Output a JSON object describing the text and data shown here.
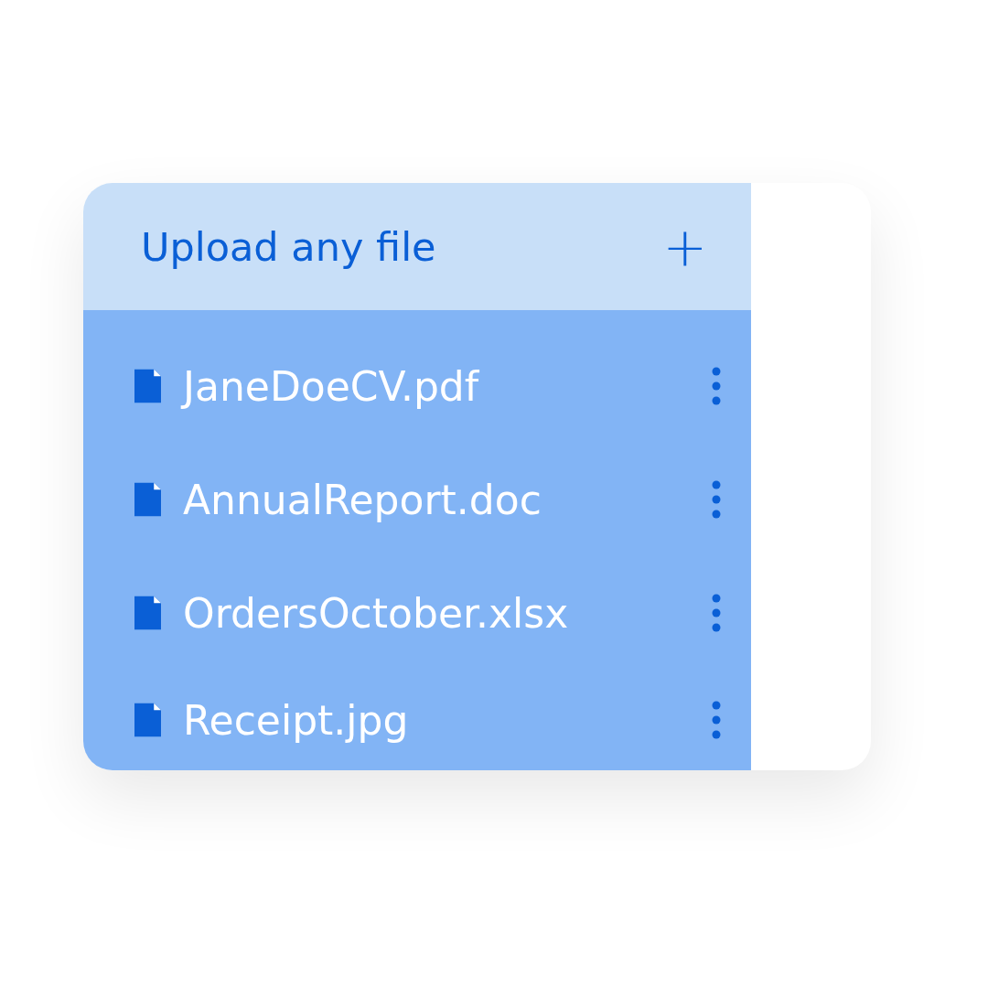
{
  "upload": {
    "title": "Upload any file",
    "add_symbol": "+"
  },
  "files": [
    {
      "name": "JaneDoeCV.pdf"
    },
    {
      "name": "AnnualReport.doc"
    },
    {
      "name": "OrdersOctober.xlsx"
    },
    {
      "name": "Receipt.jpg"
    }
  ]
}
